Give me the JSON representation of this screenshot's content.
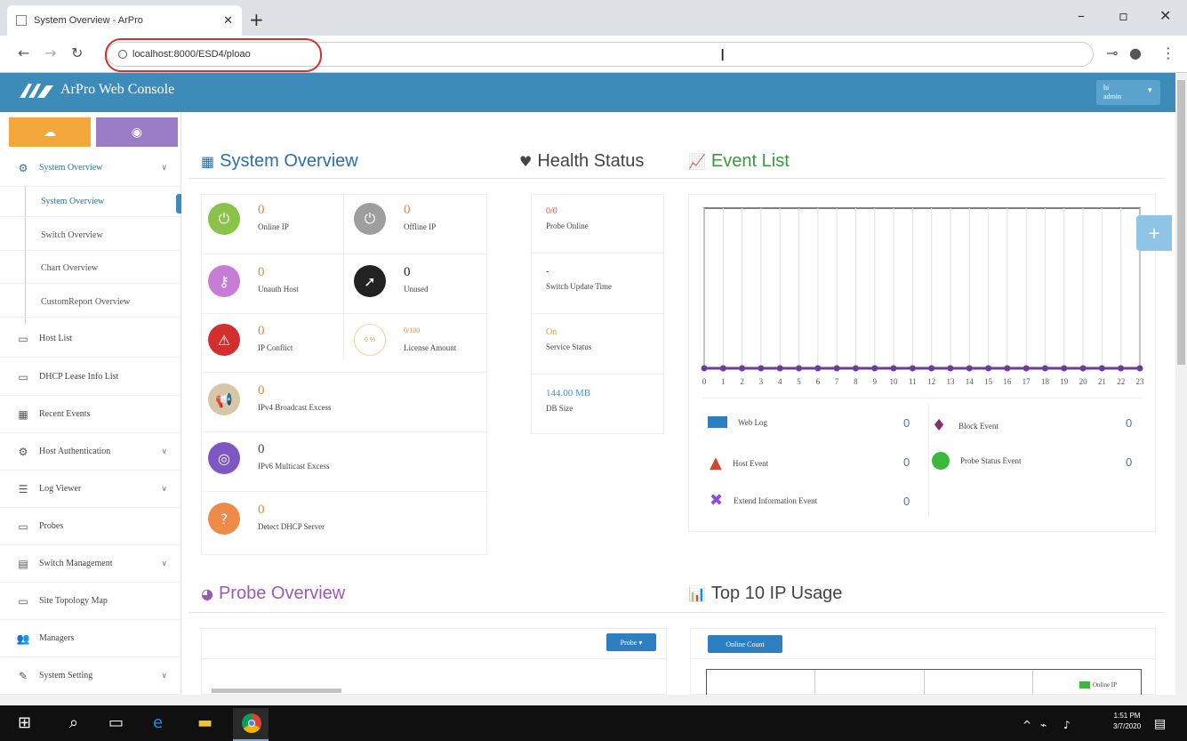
{
  "browser": {
    "tab_title": "System Overview - ArPro",
    "url": "localhost:8000/ESD4/ploao",
    "new_tab": "+",
    "minimize": "–",
    "restore": "▫",
    "close": "✕"
  },
  "app": {
    "title": "ArPro Web Console",
    "user_line1": "hi",
    "user_line2": "admin"
  },
  "sidebar": {
    "items": [
      {
        "label": "System Overview",
        "icon": "sitemap-icon"
      },
      {
        "label": "Host List",
        "icon": "desktop-icon"
      },
      {
        "label": "DHCP Lease Info List",
        "icon": "monitor-icon"
      },
      {
        "label": "Recent Events",
        "icon": "calendar-icon"
      },
      {
        "label": "Host Authentication",
        "icon": "gears-icon"
      },
      {
        "label": "Log Viewer",
        "icon": "list-icon"
      },
      {
        "label": "Probes",
        "icon": "desktop-icon"
      },
      {
        "label": "Switch Management",
        "icon": "server-icon"
      },
      {
        "label": "Site Topology Map",
        "icon": "desktop-icon"
      },
      {
        "label": "Managers",
        "icon": "users-icon"
      },
      {
        "label": "System Setting",
        "icon": "edit-icon"
      }
    ],
    "subitems": [
      {
        "label": "System Overview"
      },
      {
        "label": "Switch Overview"
      },
      {
        "label": "Chart Overview"
      },
      {
        "label": "CustomReport Overview"
      }
    ]
  },
  "overview": {
    "title": "System Overview",
    "tiles": [
      {
        "value": "0",
        "label": "Online IP",
        "color": "#8bc34a"
      },
      {
        "value": "0",
        "label": "Offline IP",
        "color": "#9e9e9e"
      },
      {
        "value": "0",
        "label": "Unauth Host",
        "color": "#c77dd6"
      },
      {
        "value": "0",
        "label": "Unused",
        "color": "#222222"
      },
      {
        "value": "0",
        "label": "IP Conflict",
        "color": "#d32f2f"
      },
      {
        "value": "0/100",
        "label": "License Amount",
        "pct": "0 %",
        "color": "#f4a73a"
      },
      {
        "value": "0",
        "label": "IPv4 Broadcast Excess",
        "color": "#d7c6a8"
      },
      {
        "value": "0",
        "label": "IPv6 Multicast Excess",
        "color": "#7e57c2"
      },
      {
        "value": "0",
        "label": "Detect DHCP Server",
        "color": "#f08a4b"
      }
    ]
  },
  "health": {
    "title": "Health Status",
    "rows": [
      {
        "value": "0/0",
        "label": "Probe Online",
        "color": "#e05040"
      },
      {
        "value": "-",
        "label": "Switch Update Time",
        "color": "#444444"
      },
      {
        "value": "On",
        "label": "Service Status",
        "color": "#e0a020"
      },
      {
        "value": "144.00 MB",
        "label": "DB Size",
        "color": "#4a90c8"
      }
    ]
  },
  "events": {
    "title": "Event List",
    "legend": [
      {
        "label": "Web Log",
        "value": "0",
        "shape": "square",
        "color": "#2e7fc2"
      },
      {
        "label": "Block Event",
        "value": "0",
        "shape": "diamond",
        "color": "#8a2b6a"
      },
      {
        "label": "Host Event",
        "value": "0",
        "shape": "triangle",
        "color": "#d2452e"
      },
      {
        "label": "Probe Status Event",
        "value": "0",
        "shape": "circle",
        "color": "#3cb83c"
      },
      {
        "label": "Extend Information Event",
        "value": "0",
        "shape": "cross",
        "color": "#8a4fd6"
      }
    ]
  },
  "probe": {
    "title": "Probe Overview",
    "button": "Probe ▾"
  },
  "top10": {
    "title": "Top 10 IP Usage",
    "button": "Online Count",
    "legend": "Online IP"
  },
  "taskbar": {
    "time": "1:51 PM",
    "date": "3/7/2020"
  },
  "chart_data": {
    "type": "line",
    "x": [
      0,
      1,
      2,
      3,
      4,
      5,
      6,
      7,
      8,
      9,
      10,
      11,
      12,
      13,
      14,
      15,
      16,
      17,
      18,
      19,
      20,
      21,
      22,
      23
    ],
    "series": [
      {
        "values": [
          0,
          0,
          0,
          0,
          0,
          0,
          0,
          0,
          0,
          0,
          0,
          0,
          0,
          0,
          0,
          0,
          0,
          0,
          0,
          0,
          0,
          0,
          0,
          0
        ],
        "color": "#6a3d9a"
      }
    ],
    "xlabel": "",
    "ylabel": "",
    "grid": true
  }
}
